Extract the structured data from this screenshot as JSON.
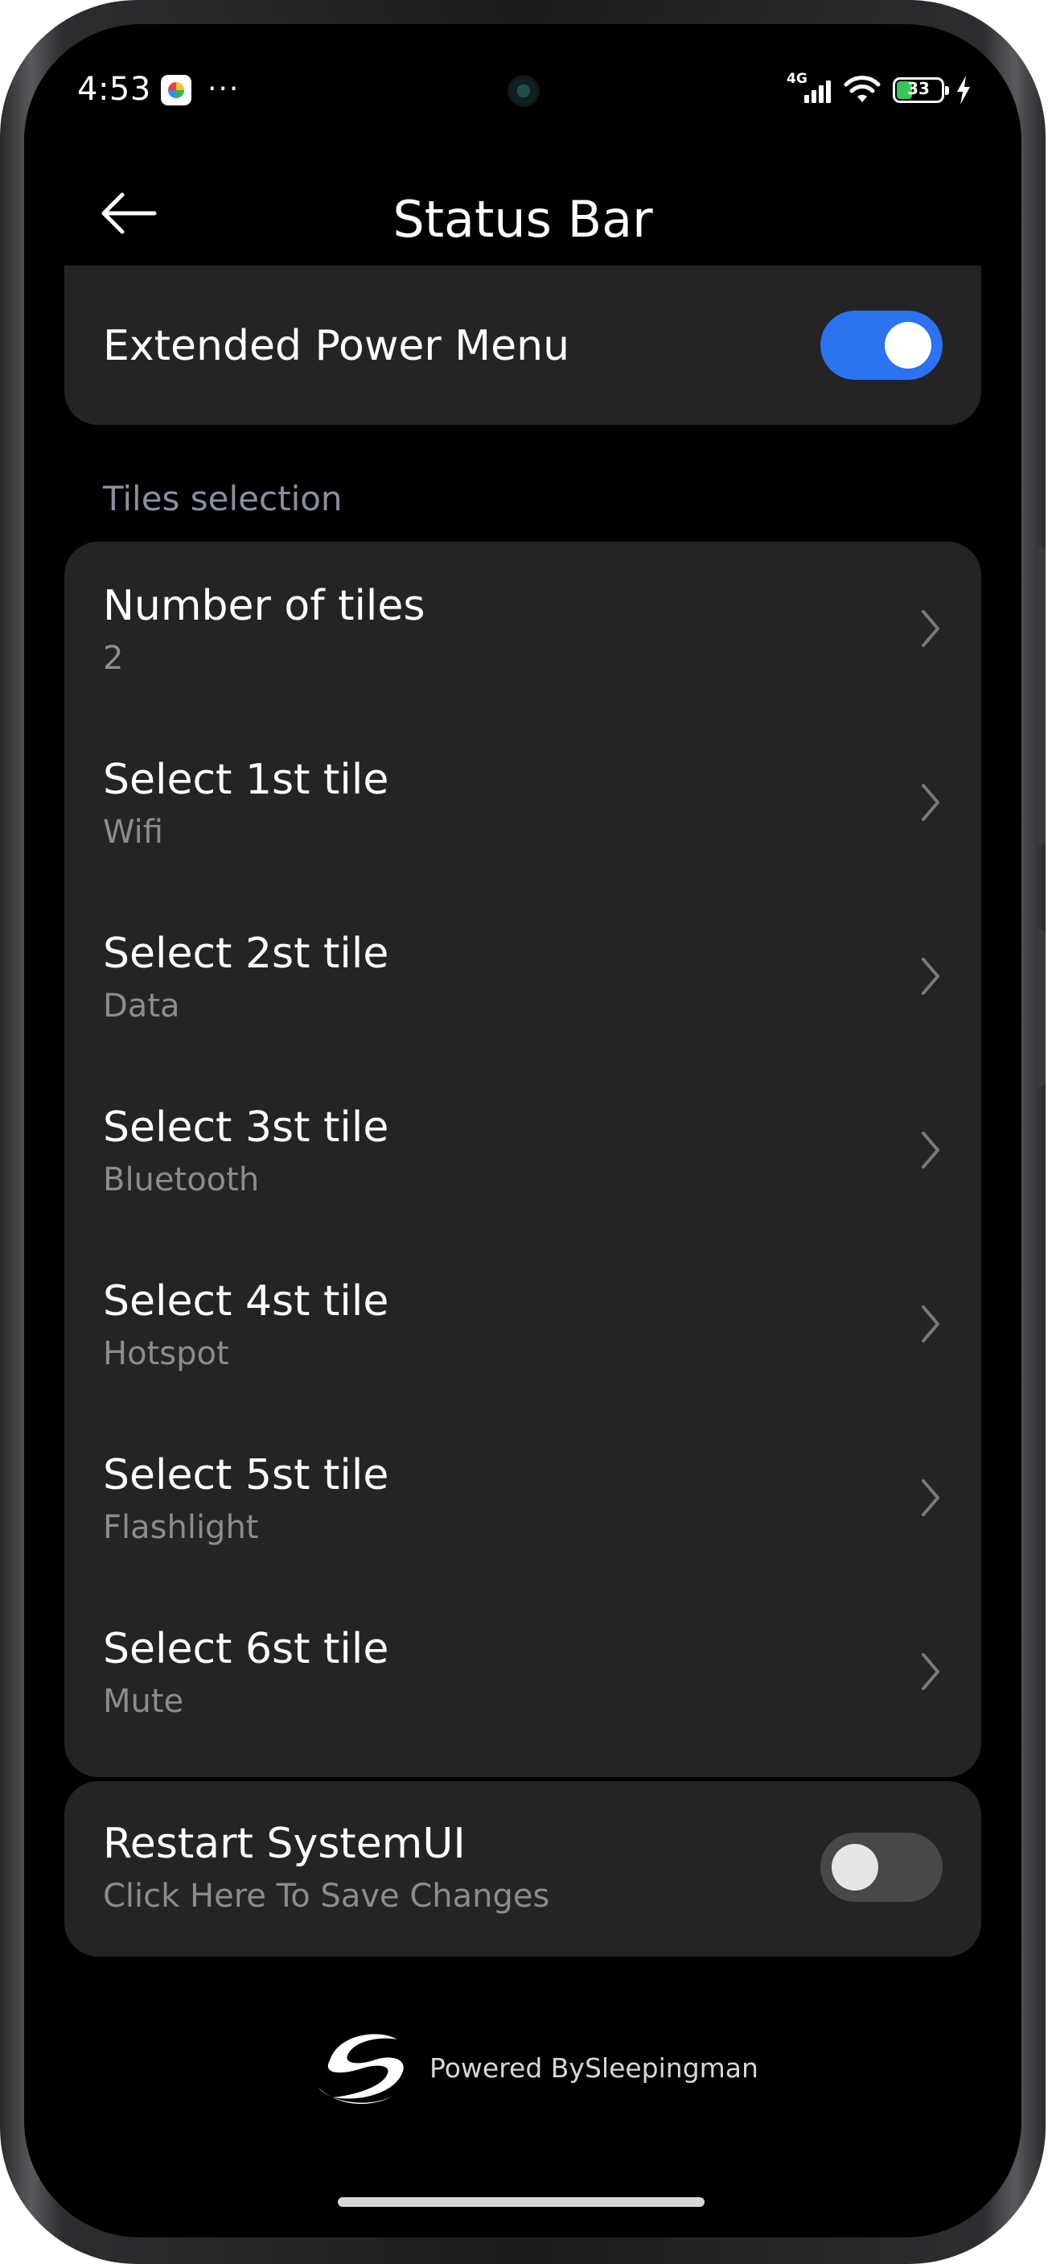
{
  "status_bar": {
    "time": "4:53",
    "more": "···",
    "network": "4G",
    "battery": "33",
    "battery_level": 0.33
  },
  "header": {
    "title": "Status Bar"
  },
  "power_menu": {
    "label": "Extended Power Menu",
    "enabled": true
  },
  "tiles_section": {
    "label": "Tiles selection",
    "items": [
      {
        "title": "Number of tiles",
        "value": "2"
      },
      {
        "title": "Select 1st tile",
        "value": "Wifi"
      },
      {
        "title": "Select 2st tile",
        "value": "Data"
      },
      {
        "title": "Select 3st tile",
        "value": "Bluetooth"
      },
      {
        "title": "Select 4st tile",
        "value": "Hotspot"
      },
      {
        "title": "Select 5st tile",
        "value": "Flashlight"
      },
      {
        "title": "Select 6st tile",
        "value": "Mute"
      }
    ]
  },
  "restart": {
    "title": "Restart SystemUI",
    "subtitle": "Click Here To Save Changes",
    "enabled": false
  },
  "footer": {
    "powered_by": "Powered BySleepingman"
  },
  "colors": {
    "accent": "#2b73f0",
    "card": "#242424",
    "background": "#000000",
    "secondary_text": "#8c8c8c"
  }
}
